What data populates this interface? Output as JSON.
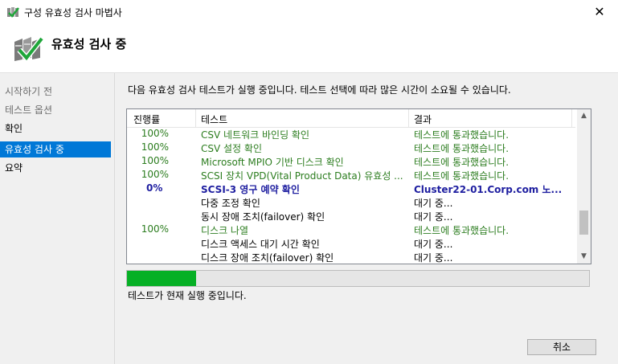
{
  "window": {
    "title": "구성 유효성 검사 마법사",
    "close_glyph": "✕"
  },
  "header": {
    "title": "유효성 검사 중"
  },
  "nav": {
    "items": [
      {
        "label": "시작하기 전",
        "state": "done"
      },
      {
        "label": "테스트 옵션",
        "state": "done"
      },
      {
        "label": "확인",
        "state": "normal"
      },
      {
        "label": "유효성 검사 중",
        "state": "active"
      },
      {
        "label": "요약",
        "state": "normal"
      }
    ]
  },
  "main": {
    "instruction": "다음 유효성 검사 테스트가 실행 중입니다. 테스트 선택에 따라 많은 시간이 소요될 수 있습니다.",
    "columns": {
      "progress": "진행률",
      "test": "테스트",
      "result": "결과"
    },
    "rows": [
      {
        "progress": "100%",
        "test": "CSV 네트워크 바인딩 확인",
        "result": "테스트에 통과했습니다.",
        "status": "passed"
      },
      {
        "progress": "100%",
        "test": "CSV 설정 확인",
        "result": "테스트에 통과했습니다.",
        "status": "passed"
      },
      {
        "progress": "100%",
        "test": "Microsoft MPIO 기반 디스크 확인",
        "result": "테스트에 통과했습니다.",
        "status": "passed"
      },
      {
        "progress": "100%",
        "test": "SCSI 장치 VPD(Vital Product Data) 유효성 ...",
        "result": "테스트에 통과했습니다.",
        "status": "passed"
      },
      {
        "progress": "0%",
        "test": "SCSI-3 영구 예약 확인",
        "result": "Cluster22-01.Corp.com 노...",
        "status": "running"
      },
      {
        "progress": "",
        "test": "다중 조정 확인",
        "result": "대기 중...",
        "status": "pending"
      },
      {
        "progress": "",
        "test": "동시 장애 조치(failover) 확인",
        "result": "대기 중...",
        "status": "pending"
      },
      {
        "progress": "100%",
        "test": "디스크 나열",
        "result": "테스트에 통과했습니다.",
        "status": "passed"
      },
      {
        "progress": "",
        "test": "디스크 액세스 대기 시간 확인",
        "result": "대기 중...",
        "status": "pending"
      },
      {
        "progress": "",
        "test": "디스크 장애 조치(failover) 확인",
        "result": "대기 중...",
        "status": "pending"
      }
    ],
    "overall_progress": 0.15,
    "status_text": "테스트가 현재 실행 중입니다.",
    "cancel_label": "취소"
  },
  "colors": {
    "accent": "#0078d7",
    "passed": "#2c7d1f",
    "running": "#1e1ea0",
    "progress_fill": "#06b025"
  },
  "icons": {
    "app": "cluster-validate-icon",
    "header": "cluster-validate-icon",
    "scroll_up": "chevron-up-icon",
    "scroll_down": "chevron-down-icon"
  }
}
